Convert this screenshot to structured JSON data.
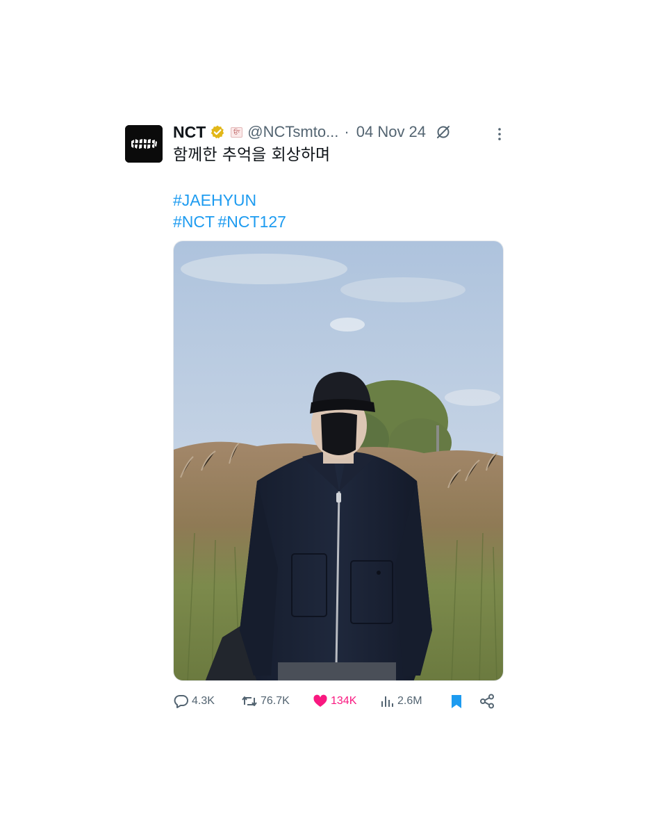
{
  "tweet": {
    "author_name": "NCT",
    "affiliate_badge": "ਓਾ",
    "handle": "@NCTsmto...",
    "separator": "·",
    "date": "04 Nov 24",
    "text": "함께한 추억을 회상하며",
    "hashtag_line1": "#JAEHYUN",
    "hashtag_line2a": "#NCT",
    "hashtag_line2b": "#NCT127",
    "image_alt": "Person in black cap, black mask and navy zip jacket standing in front of tall grass under a blue sky"
  },
  "actions": {
    "replies": "4.3K",
    "reposts": "76.7K",
    "likes": "134K",
    "views": "2.6M"
  },
  "colors": {
    "text": "#0f1419",
    "secondary": "#536471",
    "link": "#1d9bf0",
    "like": "#f91880",
    "bookmark": "#1d9bf0",
    "verified_gold": "#e2b719"
  },
  "icons": [
    "verified-badge-icon",
    "grok-icon",
    "more-icon",
    "reply-icon",
    "repost-icon",
    "like-icon",
    "views-icon",
    "bookmark-icon",
    "share-icon"
  ]
}
